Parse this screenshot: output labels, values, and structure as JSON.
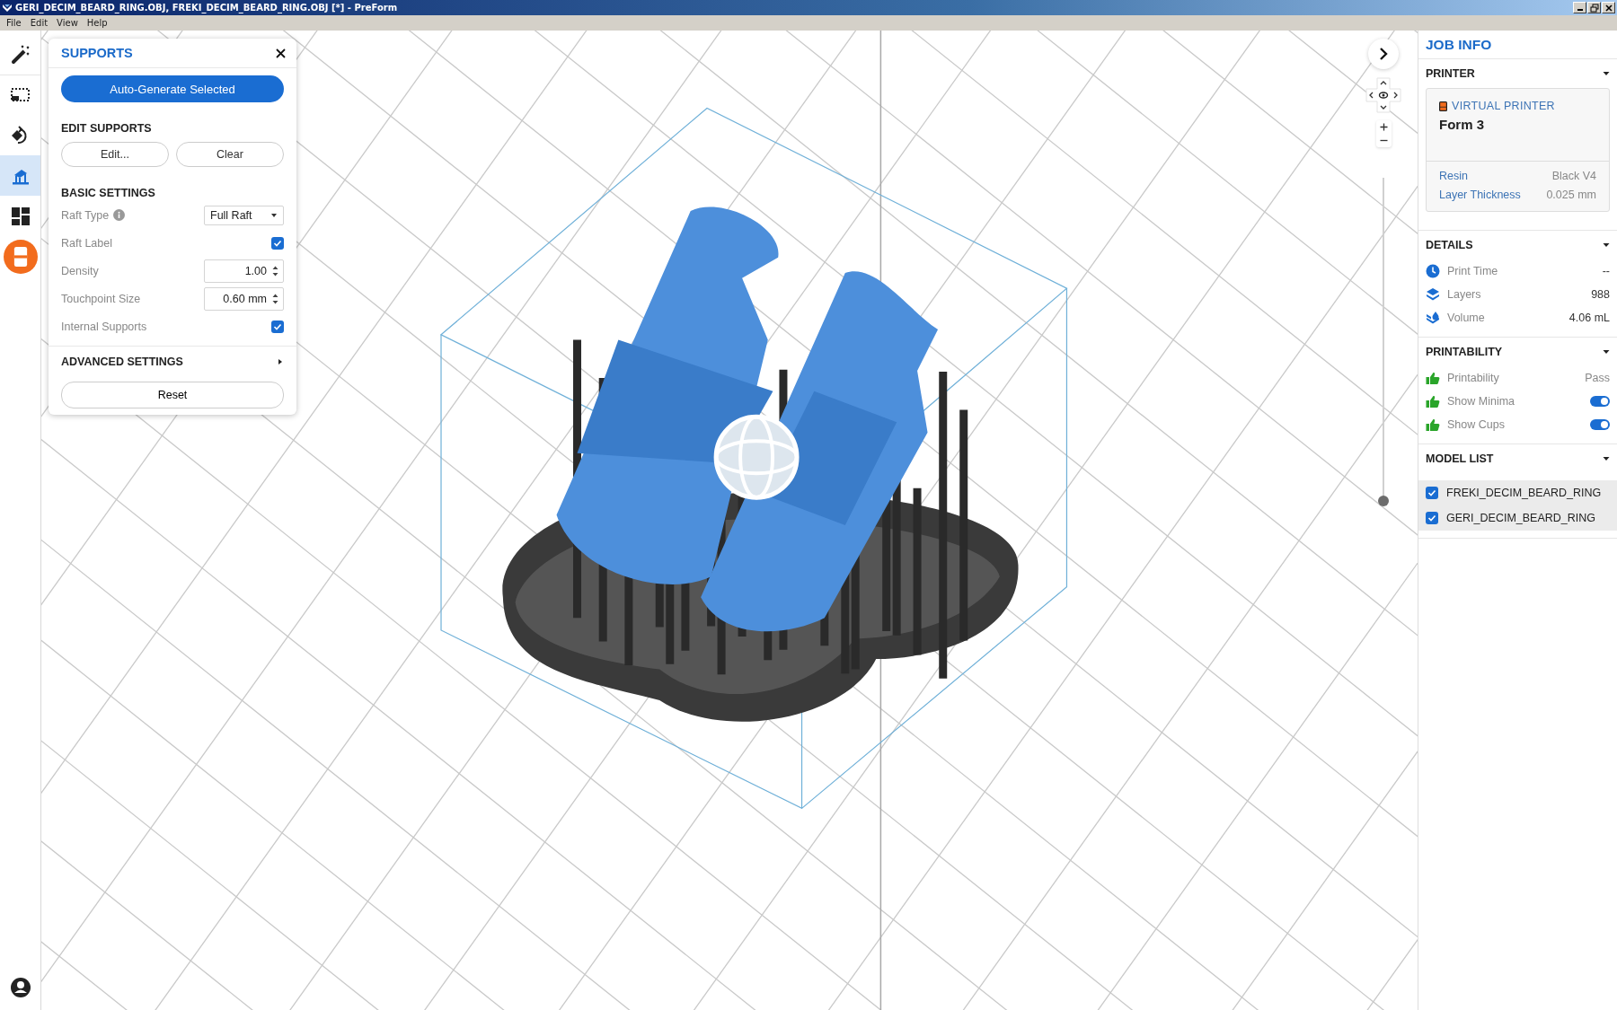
{
  "window": {
    "title": "GERI_DECIM_BEARD_RING.OBJ, FREKI_DECIM_BEARD_RING.OBJ [*] - PreForm"
  },
  "menu": [
    "File",
    "Edit",
    "View",
    "Help"
  ],
  "toolbar": [
    {
      "kind": "wand",
      "selected": false
    },
    {
      "kind": "select",
      "selected": false
    },
    {
      "kind": "orient",
      "selected": false
    },
    {
      "kind": "supports",
      "selected": true
    },
    {
      "kind": "layout",
      "selected": false
    },
    {
      "kind": "printer",
      "selected": false
    }
  ],
  "supports_panel": {
    "title": "SUPPORTS",
    "primary_button": "Auto-Generate Selected",
    "edit_heading": "EDIT SUPPORTS",
    "edit_buttons": [
      "Edit...",
      "Clear"
    ],
    "basic_heading": "BASIC SETTINGS",
    "settings": [
      {
        "kind": "dropdown",
        "label": "Raft Type",
        "info": true,
        "value": "Full Raft"
      },
      {
        "kind": "checkbox",
        "label": "Raft Label",
        "checked": true
      },
      {
        "kind": "spinner",
        "label": "Density",
        "value": "1.00"
      },
      {
        "kind": "spinner",
        "label": "Touchpoint Size",
        "value": "0.60 mm"
      },
      {
        "kind": "checkbox",
        "label": "Internal Supports",
        "checked": true
      }
    ],
    "advanced": {
      "label": "ADVANCED SETTINGS",
      "expanded": false
    },
    "reset_button": "Reset"
  },
  "layer_slider": {
    "level": 0
  },
  "job_info": {
    "title": "JOB INFO",
    "printer": {
      "heading": "PRINTER",
      "expanded": true,
      "tag": "VIRTUAL PRINTER",
      "name": "Form 3",
      "rows": [
        {
          "label": "Resin",
          "value": "Black V4"
        },
        {
          "label": "Layer Thickness",
          "value": "0.025 mm"
        }
      ]
    },
    "details": {
      "heading": "DETAILS",
      "expanded": true,
      "rows": [
        {
          "kind": "clock",
          "label": "Print Time",
          "value": "--"
        },
        {
          "kind": "layers",
          "label": "Layers",
          "value": "988"
        },
        {
          "kind": "volume",
          "label": "Volume",
          "value": "4.06 mL"
        }
      ]
    },
    "printability": {
      "heading": "PRINTABILITY",
      "expanded": true,
      "rows": [
        {
          "kind": "status",
          "label": "Printability",
          "value": "Pass"
        },
        {
          "kind": "toggle",
          "label": "Show Minima",
          "on": true
        },
        {
          "kind": "toggle",
          "label": "Show Cups",
          "on": true
        }
      ]
    },
    "model_list": {
      "heading": "MODEL LIST",
      "expanded": true,
      "items": [
        {
          "name": "FREKI_DECIM_BEARD_RING",
          "checked": true,
          "selected": true
        },
        {
          "name": "GERI_DECIM_BEARD_RING",
          "checked": true,
          "selected": true
        }
      ]
    }
  }
}
